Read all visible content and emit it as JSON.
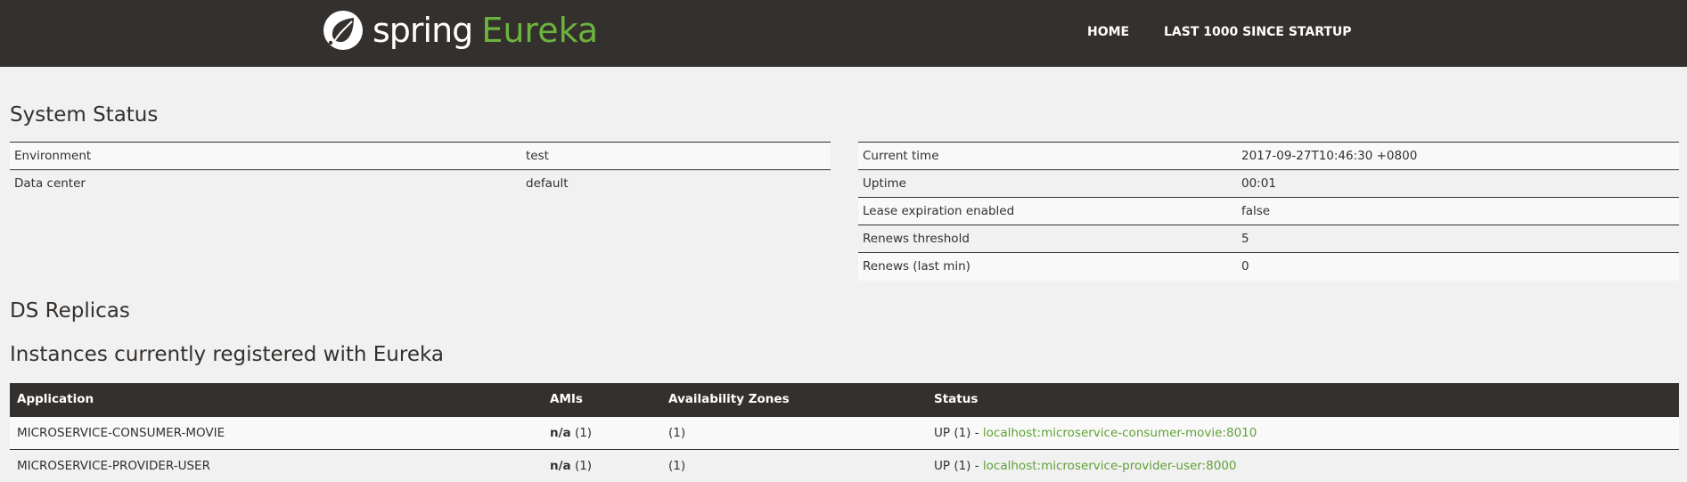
{
  "navbar": {
    "brand_spring": "spring",
    "brand_eureka": "Eureka",
    "links": [
      {
        "label": "HOME"
      },
      {
        "label": "LAST 1000 SINCE STARTUP"
      }
    ]
  },
  "headings": {
    "system_status": "System Status",
    "ds_replicas": "DS Replicas",
    "instances": "Instances currently registered with Eureka"
  },
  "system_left": [
    {
      "key": "Environment",
      "value": "test"
    },
    {
      "key": "Data center",
      "value": "default"
    }
  ],
  "system_right": [
    {
      "key": "Current time",
      "value": "2017-09-27T10:46:30 +0800"
    },
    {
      "key": "Uptime",
      "value": "00:01"
    },
    {
      "key": "Lease expiration enabled",
      "value": "false"
    },
    {
      "key": "Renews threshold",
      "value": "5"
    },
    {
      "key": "Renews (last min)",
      "value": "0"
    }
  ],
  "instances": {
    "headers": [
      "Application",
      "AMIs",
      "Availability Zones",
      "Status"
    ],
    "rows": [
      {
        "application": "MICROSERVICE-CONSUMER-MOVIE",
        "ami_bold": "n/a",
        "ami_count": "(1)",
        "zones": "(1)",
        "status_prefix": "UP",
        "status_count": "(1) -",
        "link": "localhost:microservice-consumer-movie:8010"
      },
      {
        "application": "MICROSERVICE-PROVIDER-USER",
        "ami_bold": "n/a",
        "ami_count": "(1)",
        "zones": "(1)",
        "status_prefix": "UP",
        "status_count": "(1) -",
        "link": "localhost:microservice-provider-user:8000"
      }
    ]
  },
  "colors": {
    "navbar_bg": "#34302d",
    "brand_green": "#6db33f",
    "link_green": "#5fa134",
    "page_bg": "#f1f1f1"
  },
  "icons": {
    "brand_logo": "spring-leaf-icon"
  }
}
